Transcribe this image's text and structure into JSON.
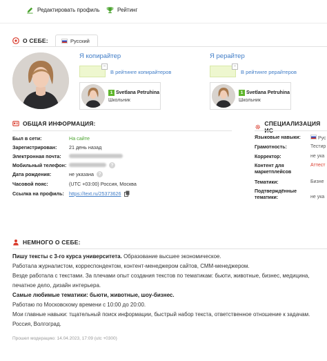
{
  "toolbar": {
    "edit_profile": "Редактировать профиль",
    "rating": "Рейтинг"
  },
  "about_header": {
    "title": "О СЕБЕ:",
    "tab_language": "Русский"
  },
  "roles": {
    "copywriter_title": "Я копирайтер",
    "copywriter_link": "В рейтинге копирайтеров",
    "rewriter_title": "Я рерайтер",
    "rewriter_link": "В рейтинге рерайтеров",
    "card_level": "1",
    "card_name": "Svetlana Petruhina",
    "card_rank": "Школьник"
  },
  "general": {
    "title": "ОБЩАЯ ИНФОРМАЦИЯ:",
    "rows": [
      {
        "label": "Был в сети:",
        "value": "На сайте"
      },
      {
        "label": "Зарегистрирован:",
        "value": "21 день назад"
      },
      {
        "label": "Электронная почта:",
        "value": ""
      },
      {
        "label": "Мобильный телефон:",
        "value": ""
      },
      {
        "label": "Дата рождения:",
        "value": "не указана"
      },
      {
        "label": "Часовой пояс:",
        "value": "(UTC +03:00) Россия, Москва"
      },
      {
        "label": "Ссылка на профиль:",
        "value": "https://text.ru/25373626"
      }
    ]
  },
  "specialization": {
    "title": "СПЕЦИАЛИЗАЦИЯ ИС",
    "rows": [
      {
        "label": "Языковые навыки:",
        "value": "Рус"
      },
      {
        "label": "Грамотность:",
        "value": "Тестир"
      },
      {
        "label": "Корректор:",
        "value": "не ука"
      },
      {
        "label": "Контент для маркетплейсов",
        "value": "Аттест"
      },
      {
        "label": "Тематики:",
        "value": "Бизне"
      },
      {
        "label": "Подтверждённые тематики:",
        "value": "не ука"
      }
    ]
  },
  "bio": {
    "title": "НЕМНОГО О СЕБЕ:",
    "line1_bold": "Пишу тексты с 3-го курса университета.",
    "line1_rest": " Образование высшее экономическое.",
    "line2": "Работала журналистом, корреспондентом, контент-менеджером сайтов, СММ-менеджером.",
    "line3": "Везде работала с текстами. За плечами опыт создания текстов по тематикам: бьюти, животные, бизнес, медицина,",
    "line4": "печатное дело, дизайн интерьера.",
    "line5": "Самые любимые тематики: бьюти, животные, шоу-бизнес.",
    "line6": "Работаю по Московскому времени с 10:00 до 20:00.",
    "line7": "Мои главные навыки: тщательный поиск информации, быстрый набор текста, ответственное отношение к задачам.",
    "line8": "Россия, Волгоград."
  },
  "footer": {
    "moderation": "Прошел модерацию: 14.04.2023, 17:09 (utc +0300)"
  },
  "colors": {
    "accent_red": "#d93a2b",
    "link_blue": "#3f7cc7",
    "online_green": "#4aa32e",
    "level_green": "#5fb52d"
  }
}
